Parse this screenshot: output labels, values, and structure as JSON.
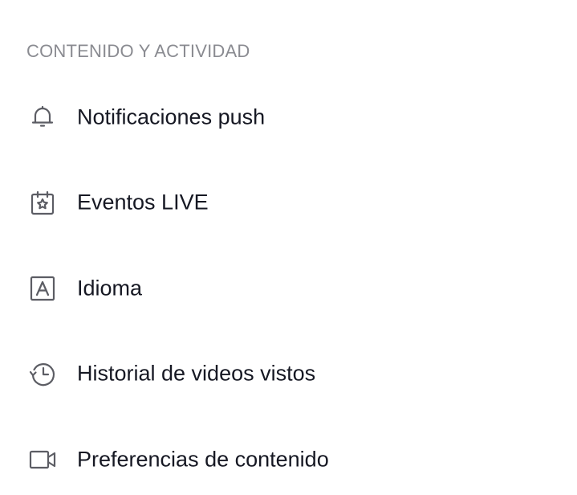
{
  "section": {
    "title": "CONTENIDO Y ACTIVIDAD"
  },
  "menu": {
    "items": [
      {
        "label": "Notificaciones push",
        "icon": "bell-icon"
      },
      {
        "label": "Eventos LIVE",
        "icon": "calendar-star-icon"
      },
      {
        "label": "Idioma",
        "icon": "language-letter-icon"
      },
      {
        "label": "Historial de videos vistos",
        "icon": "history-clock-icon"
      },
      {
        "label": "Preferencias de contenido",
        "icon": "video-camera-icon"
      }
    ]
  },
  "colors": {
    "section_title": "#8a8b91",
    "text": "#161823",
    "icon_stroke": "#5c5d64",
    "background": "#ffffff"
  }
}
